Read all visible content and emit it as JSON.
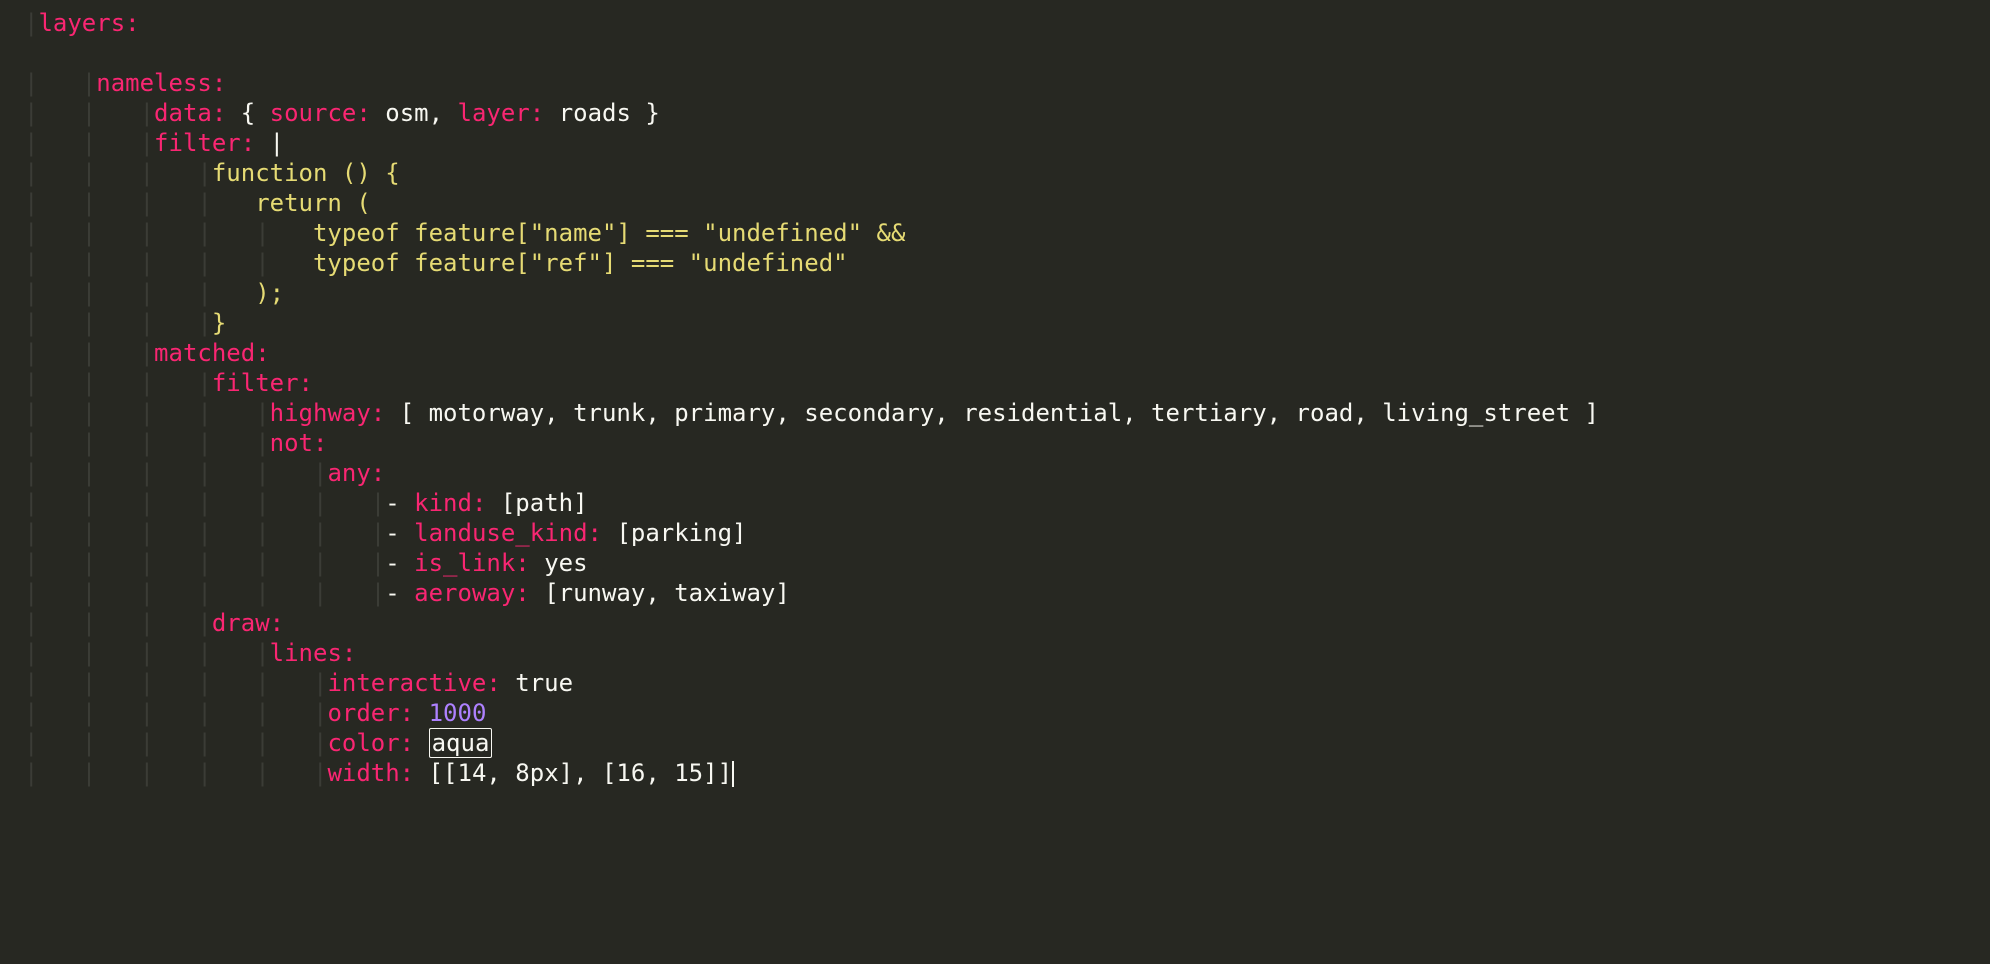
{
  "code": {
    "k_layers": "layers:",
    "k_nameless": "nameless:",
    "k_data": "data:",
    "brace_open": "{",
    "k_source": "source:",
    "v_osm": "osm",
    "comma": ",",
    "k_layer": "layer:",
    "v_roads": "roads",
    "brace_close": "}",
    "k_filter": "filter:",
    "pipe": "|",
    "js_l1": "function () {",
    "js_l2": "return (",
    "js_l3": "typeof feature[\"name\"] === \"undefined\" &&",
    "js_l4": "typeof feature[\"ref\"] === \"undefined\"",
    "js_l5": ");",
    "js_l6": "}",
    "k_matched": "matched:",
    "k_filter2": "filter:",
    "k_highway": "highway:",
    "v_highway": "[ motorway, trunk, primary, secondary, residential, tertiary, road, living_street ]",
    "k_not": "not:",
    "k_any": "any:",
    "dash": "-",
    "k_kind": "kind:",
    "v_kind": "[path]",
    "k_landuse_kind": "landuse_kind:",
    "v_landuse_kind": "[parking]",
    "k_is_link": "is_link:",
    "v_is_link": "yes",
    "k_aeroway": "aeroway:",
    "v_aeroway": "[runway, taxiway]",
    "k_draw": "draw:",
    "k_lines": "lines:",
    "k_interactive": "interactive:",
    "v_interactive": "true",
    "k_order": "order:",
    "v_order": "1000",
    "k_color": "color:",
    "v_color": "aqua",
    "k_width": "width:",
    "v_width": "[[14, 8px], [16, 15]]"
  }
}
